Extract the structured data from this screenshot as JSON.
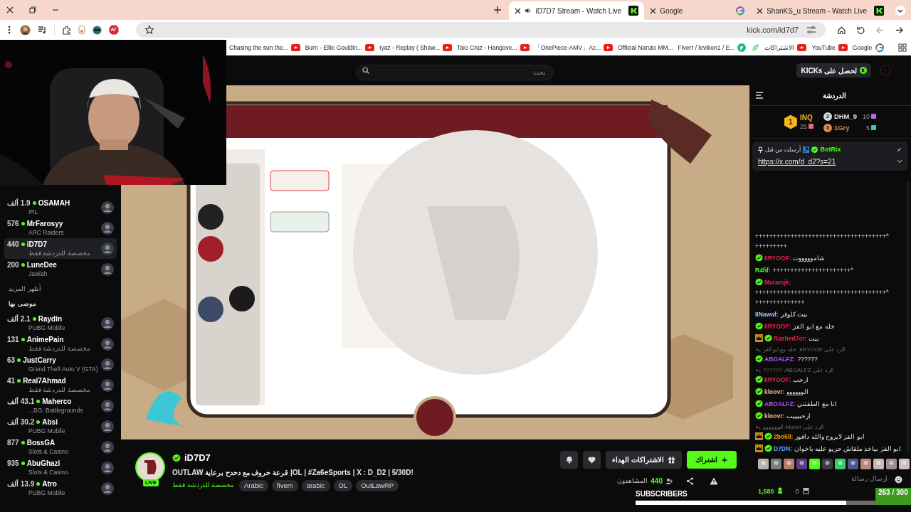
{
  "browser": {
    "tabs": [
      {
        "title": "ShanKS_u Stream - Watch Live",
        "kind": "kick",
        "audio": false,
        "selected": false
      },
      {
        "title": "Google",
        "kind": "google",
        "audio": false,
        "selected": false
      },
      {
        "title": "iD7D7 Stream - Watch Live",
        "kind": "kick",
        "audio": true,
        "selected": true
      }
    ],
    "url": "kick.com/id7d7",
    "bookmarks": [
      {
        "title": "Google",
        "kind": "google"
      },
      {
        "title": "YouTube",
        "kind": "youtube"
      },
      {
        "title": "الاشتراكات",
        "kind": "youtube"
      },
      {
        "kind": "leaf"
      },
      {
        "title": "Fiverr / levikon1 / E...",
        "kind": "fiverr"
      },
      {
        "title": "Official Naruto MM...",
        "kind": "plain"
      },
      {
        "title": "「OnePiece-AMV」Ac...",
        "kind": "youtube"
      },
      {
        "title": "Taio Cruz - Hangove...",
        "kind": "youtube"
      },
      {
        "title": "Iyaz - Replay ( Shaw...",
        "kind": "youtube"
      },
      {
        "title": "Burn - Ellie Gouldin...",
        "kind": "youtube"
      },
      {
        "title": "Chasing the sun the...",
        "kind": "youtube"
      }
    ]
  },
  "header": {
    "search": {
      "placeholder": "بحث"
    },
    "kicks_button": "لحصل على KICKs"
  },
  "sidebar": {
    "following": [
      {
        "viewers": "1.9 ألف",
        "name": "OSAMAH",
        "category": "IRL",
        "selected": false
      },
      {
        "viewers": "576",
        "name": "MrFarosyy",
        "category": "ARC Raiders",
        "selected": false
      },
      {
        "viewers": "440",
        "name": "iD7D7",
        "category": "مخصصة للدردشة فقط",
        "selected": true
      },
      {
        "viewers": "200",
        "name": "LuneDee",
        "category": "Jawlah",
        "selected": false
      }
    ],
    "show_more": "أظهر المزيد",
    "recommended_title": "موصى بها",
    "recommended": [
      {
        "viewers": "2.1 ألف",
        "name": "Raydin",
        "category": "PUBG Mobile",
        "selected": false
      },
      {
        "viewers": "131",
        "name": "AnimePain",
        "category": "مخصصة للدردشة فقط",
        "selected": false
      },
      {
        "viewers": "63",
        "name": "JustCarry",
        "category": "Grand Theft Auto V (GTA)",
        "selected": false
      },
      {
        "viewers": "41",
        "name": "Real7Ahmad",
        "category": "مخصصة للدردشة فقط",
        "selected": false
      },
      {
        "viewers": "43.1 ألف",
        "name": "Maherco",
        "category": "...BG: Battlegrounds",
        "selected": false
      },
      {
        "viewers": "30.2 ألف",
        "name": "Absi",
        "category": "PUBG Mobile",
        "selected": false
      },
      {
        "viewers": "877",
        "name": "BossGA",
        "category": "Slots & Casino",
        "selected": false
      },
      {
        "viewers": "935",
        "name": "AbuGhazi",
        "category": "Slots & Casino",
        "selected": false
      },
      {
        "viewers": "13.9 ألف",
        "name": "Atro",
        "category": "PUBG Mobile",
        "selected": false
      }
    ]
  },
  "stream": {
    "name": "iD7D7",
    "live_badge": "LIVE",
    "title": "!OL | #Za6eSports | X : D_D2 | 5/30D| قرعة حروف مع دحدح برعاية OUTLAW",
    "category": "مخصصة للدردشة فقط",
    "tags": [
      "OutLawRP",
      "OL",
      "arabic",
      "fivem",
      "Arabic"
    ],
    "gift_button": "الاشتراكات الهداء",
    "subscribe_button": "اشتراك",
    "viewers_label": "المشاهدون",
    "viewers": "440"
  },
  "goal": {
    "label": "SUBSCRIBERS",
    "level": 0.877,
    "count": "263 / 300"
  },
  "chat": {
    "title": "الدردشة",
    "leaderboard": [
      {
        "kind": "runner",
        "rank": "2",
        "name": "DHM_9",
        "count": "10"
      },
      {
        "kind": "runner",
        "rank": "3",
        "name": "1Gry",
        "count": "5"
      },
      {
        "kind": "top",
        "rank": "1",
        "name": "INQ",
        "count": "25"
      }
    ],
    "pinned": {
      "user": "BotRix",
      "label": "أرسلت من قبل",
      "link": "https://x.com/d_d2?s=21"
    },
    "messages": [
      {
        "kind": "message",
        "crown": false,
        "verified": false,
        "text": "+++++++++++++++++++++++++++++++++++++^ +++++++++"
      },
      {
        "kind": "message",
        "user": "IIRYOOF:",
        "color": "#e0284a",
        "crown": false,
        "verified": true,
        "text": "شاموووووت"
      },
      {
        "kind": "message",
        "user": "R4fif:",
        "color": "#53fc18",
        "crown": false,
        "verified": false,
        "text": "++++++++++++++++++++++^"
      },
      {
        "kind": "message",
        "user": "Maramjk:",
        "color": "#e0284a",
        "crown": false,
        "verified": true,
        "text": "+++++++++++++++++++++++++++++++++++++^ ++++++++++++++"
      },
      {
        "kind": "message",
        "user": "IINawaf:",
        "color": "#9fc5ff",
        "crown": false,
        "verified": false,
        "text": "بيت كلوفر"
      },
      {
        "kind": "message",
        "user": "IIRYOOF:",
        "color": "#e0284a",
        "crown": false,
        "verified": true,
        "text": "خله مع ابو الفز"
      },
      {
        "kind": "message",
        "user": "Rashed7cr:",
        "color": "#e0284a",
        "crown": true,
        "verified": true,
        "text": "بيت"
      },
      {
        "kind": "reply",
        "text": "الرد على IIRYOOF: خله مع ابو الفز"
      },
      {
        "kind": "message",
        "user": "ABOALFZ:",
        "color": "#a855f7",
        "crown": false,
        "verified": true,
        "text": "??????"
      },
      {
        "kind": "reply",
        "text": "الرد على ABOALFZ: ??????"
      },
      {
        "kind": "message",
        "user": "IIRYOOF:",
        "color": "#e0284a",
        "crown": false,
        "verified": true,
        "text": "ارحب"
      },
      {
        "kind": "message",
        "user": "kloovr:",
        "color": "#f4b183",
        "crown": false,
        "verified": true,
        "text": "الوووووو"
      },
      {
        "kind": "message",
        "user": "ABOALFZ:",
        "color": "#a855f7",
        "crown": false,
        "verified": true,
        "text": "انا مع الطقتني"
      },
      {
        "kind": "message",
        "user": "kloovr:",
        "color": "#f4b183",
        "crown": false,
        "verified": true,
        "text": "ارحبيييب"
      },
      {
        "kind": "reply",
        "text": "الرد على kloovr: الوووووو"
      },
      {
        "kind": "message",
        "user": "2bo5li:",
        "color": "#f59e0b",
        "crown": true,
        "verified": true,
        "text": "ابو الفز لايروح والله دافور"
      },
      {
        "kind": "message",
        "user": "D7DN:",
        "color": "#60a5fa",
        "crown": true,
        "verified": true,
        "text": "ابو الفز بياخذ ملقاش حريو عليه باخوان"
      }
    ],
    "input": {
      "placeholder": "إرسال رسالة"
    },
    "points": "1,580",
    "shop_count": "0"
  }
}
